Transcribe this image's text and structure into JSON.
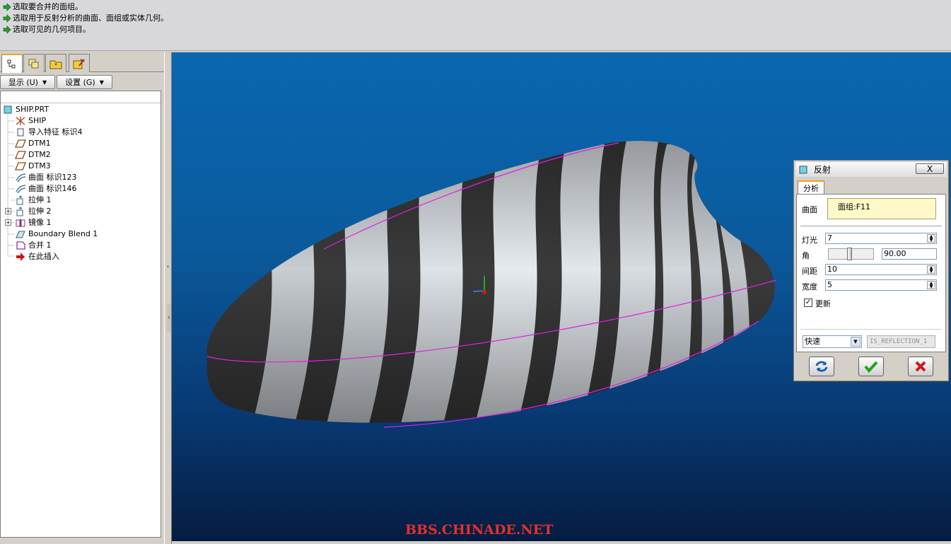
{
  "messages": [
    "选取要合并的面组。",
    "选取用于反射分析的曲面、面组或实体几何。",
    "选取可见的几何项目。"
  ],
  "left_panel": {
    "show_label": "显示 (U)",
    "settings_label": "设置 (G)",
    "tree": [
      {
        "label": "SHIP.PRT",
        "icon": "part-icon"
      },
      {
        "label": "SHIP",
        "icon": "coordinate-system-icon"
      },
      {
        "label": "导入特征 标识4",
        "icon": "import-feature-icon"
      },
      {
        "label": "DTM1",
        "icon": "datum-plane-icon"
      },
      {
        "label": "DTM2",
        "icon": "datum-plane-icon"
      },
      {
        "label": "DTM3",
        "icon": "datum-plane-icon"
      },
      {
        "label": "曲面 标识123",
        "icon": "surface-icon"
      },
      {
        "label": "曲面 标识146",
        "icon": "surface-icon"
      },
      {
        "label": "拉伸 1",
        "icon": "extrude-icon"
      },
      {
        "label": "拉伸 2",
        "icon": "extrude-icon"
      },
      {
        "label": "镜像 1",
        "icon": "mirror-icon"
      },
      {
        "label": "Boundary Blend 1",
        "icon": "boundary-blend-icon"
      },
      {
        "label": "合并 1",
        "icon": "merge-icon"
      },
      {
        "label": "在此插入",
        "icon": "insert-here-arrow-icon"
      }
    ]
  },
  "viewport": {
    "watermark": "BBS.CHINADE.NET"
  },
  "dialog": {
    "title": "反射",
    "tab": "分析",
    "surface_label": "曲面",
    "surface_value": "面组:F11",
    "light_label": "灯光",
    "light_value": "7",
    "angle_label": "角",
    "angle_value": "90.00",
    "spacing_label": "间距",
    "spacing_value": "10",
    "width_label": "宽度",
    "width_value": "5",
    "update_label": "更新",
    "mode_value": "快速",
    "result_name": "IS_REFLECTION_1",
    "close_symbol": "X"
  },
  "colors": {
    "accent": "#f0a020",
    "curve": "#e020e0",
    "viewport_top": "#0a67b0",
    "viewport_bottom": "#051c40"
  }
}
